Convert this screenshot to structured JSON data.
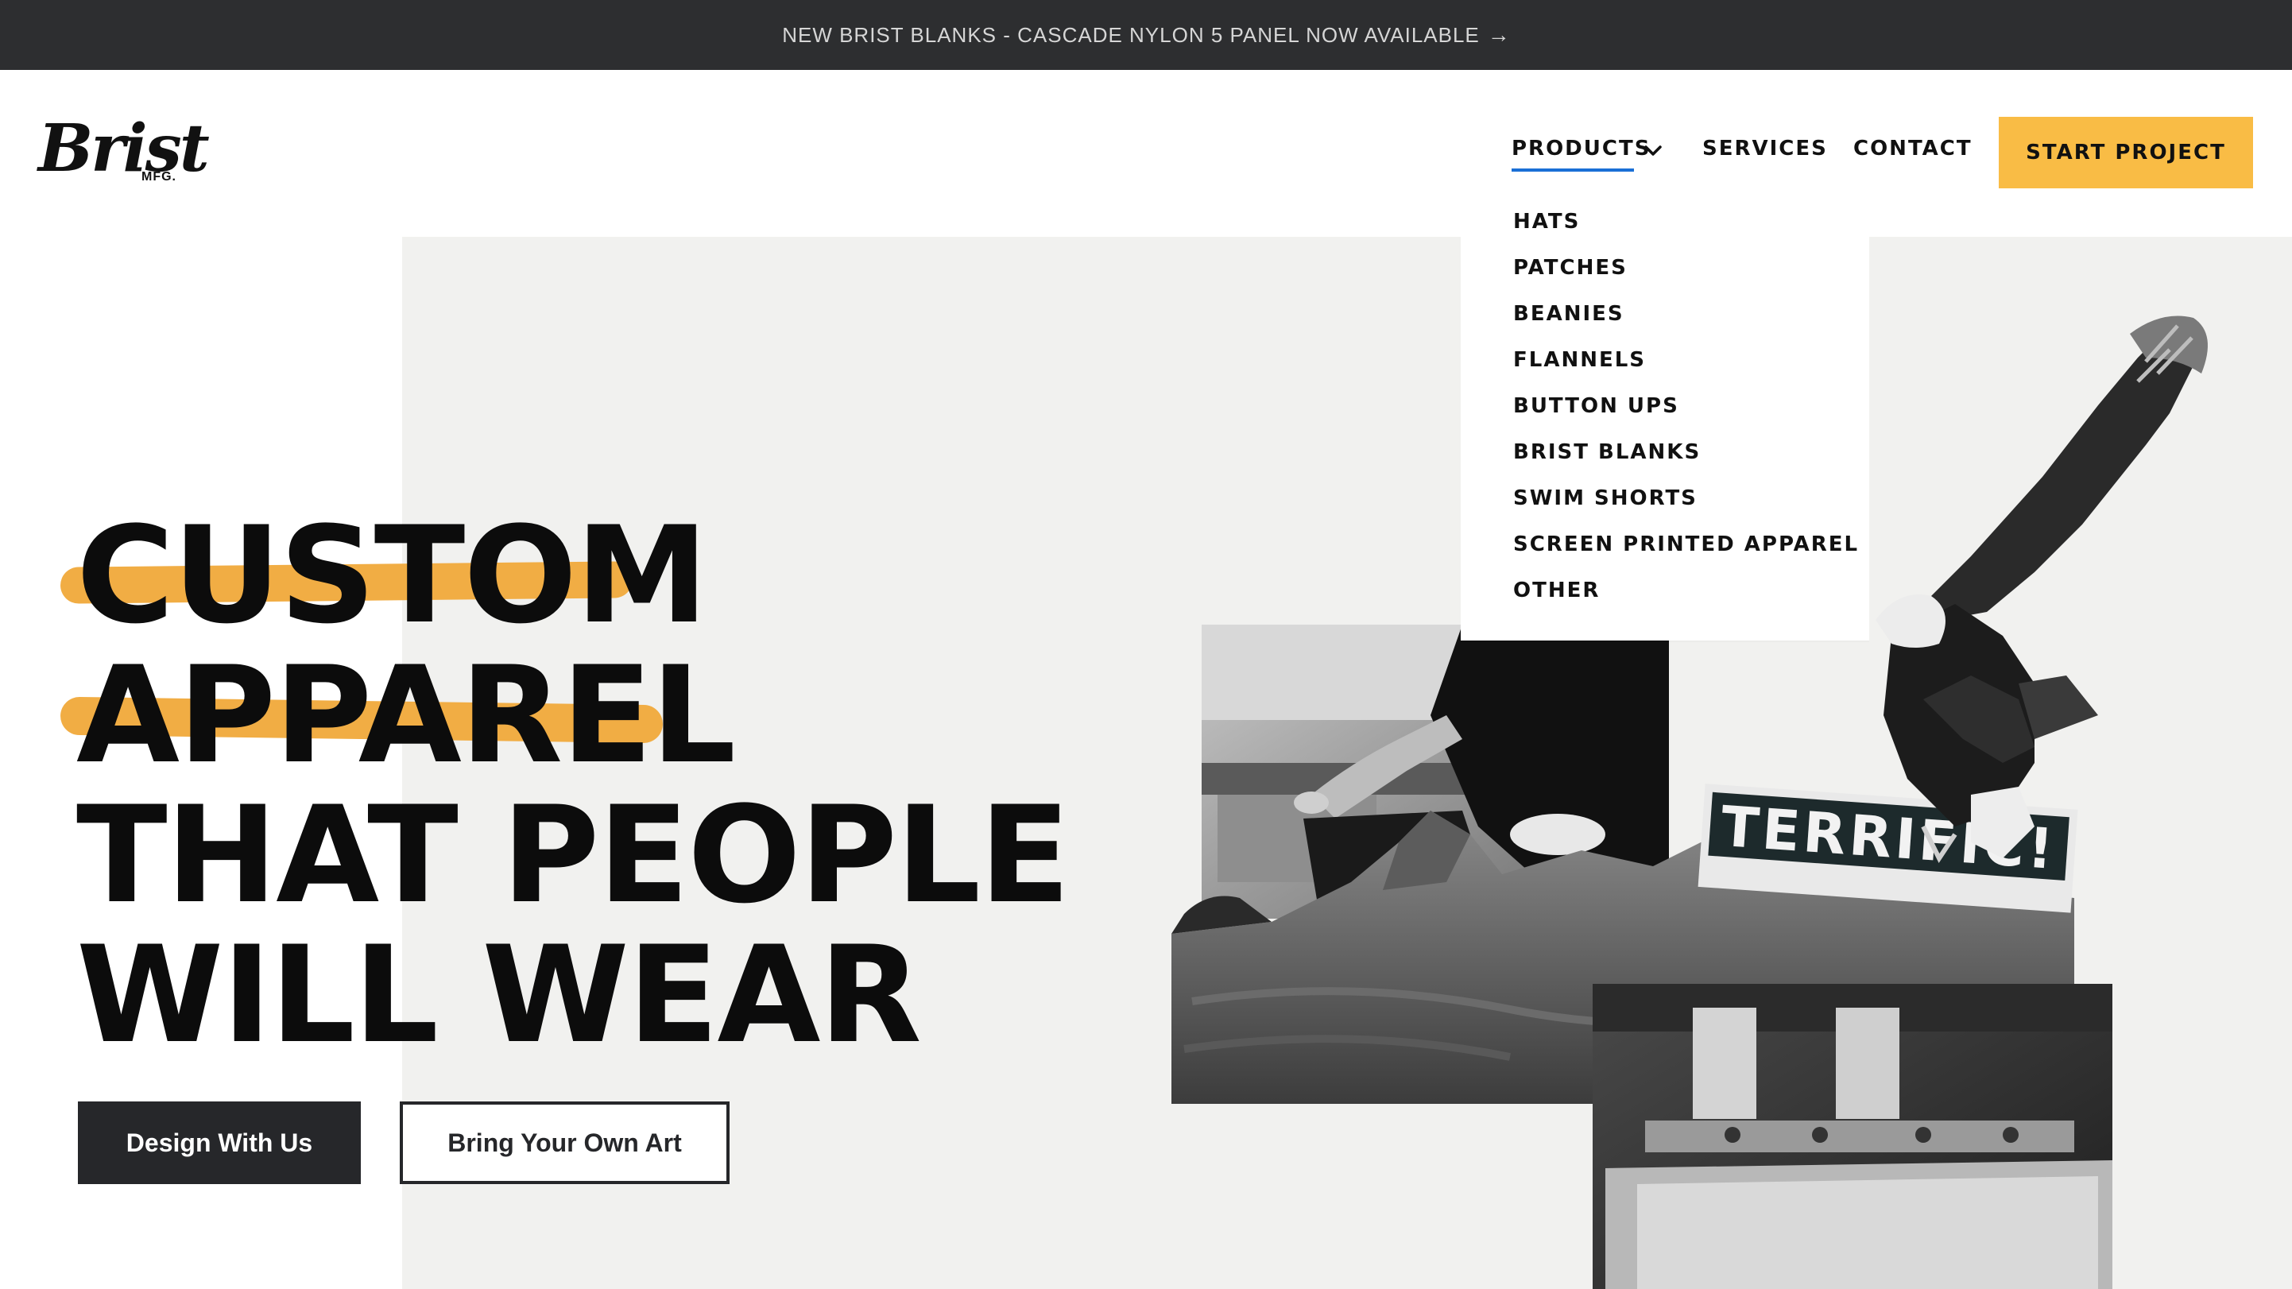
{
  "announcement": {
    "text": "NEW BRIST BLANKS - CASCADE NYLON 5 PANEL NOW AVAILABLE",
    "arrow": "→"
  },
  "brand": {
    "name": "Brist",
    "sub": "MFG."
  },
  "nav": {
    "products": "PRODUCTS",
    "services": "SERVICES",
    "contact": "CONTACT",
    "cta": "START PROJECT"
  },
  "dropdown": {
    "items": [
      "HATS",
      "PATCHES",
      "BEANIES",
      "FLANNELS",
      "BUTTON UPS",
      "BRIST BLANKS",
      "SWIM SHORTS",
      "SCREEN PRINTED APPAREL",
      "OTHER"
    ]
  },
  "hero": {
    "lines": [
      "CUSTOM",
      "APPAREL",
      "THAT PEOPLE",
      "WILL WEAR"
    ],
    "primary_button": "Design With Us",
    "secondary_button": "Bring Your Own Art",
    "sticker_text": "TERRIFIC!"
  },
  "colors": {
    "accent": "#f9bc45",
    "highlight": "#f0a93a",
    "dark": "#26272a",
    "bar": "#2d2e30",
    "panel": "#f1f1ef",
    "link_underline": "#1a6fd6"
  }
}
